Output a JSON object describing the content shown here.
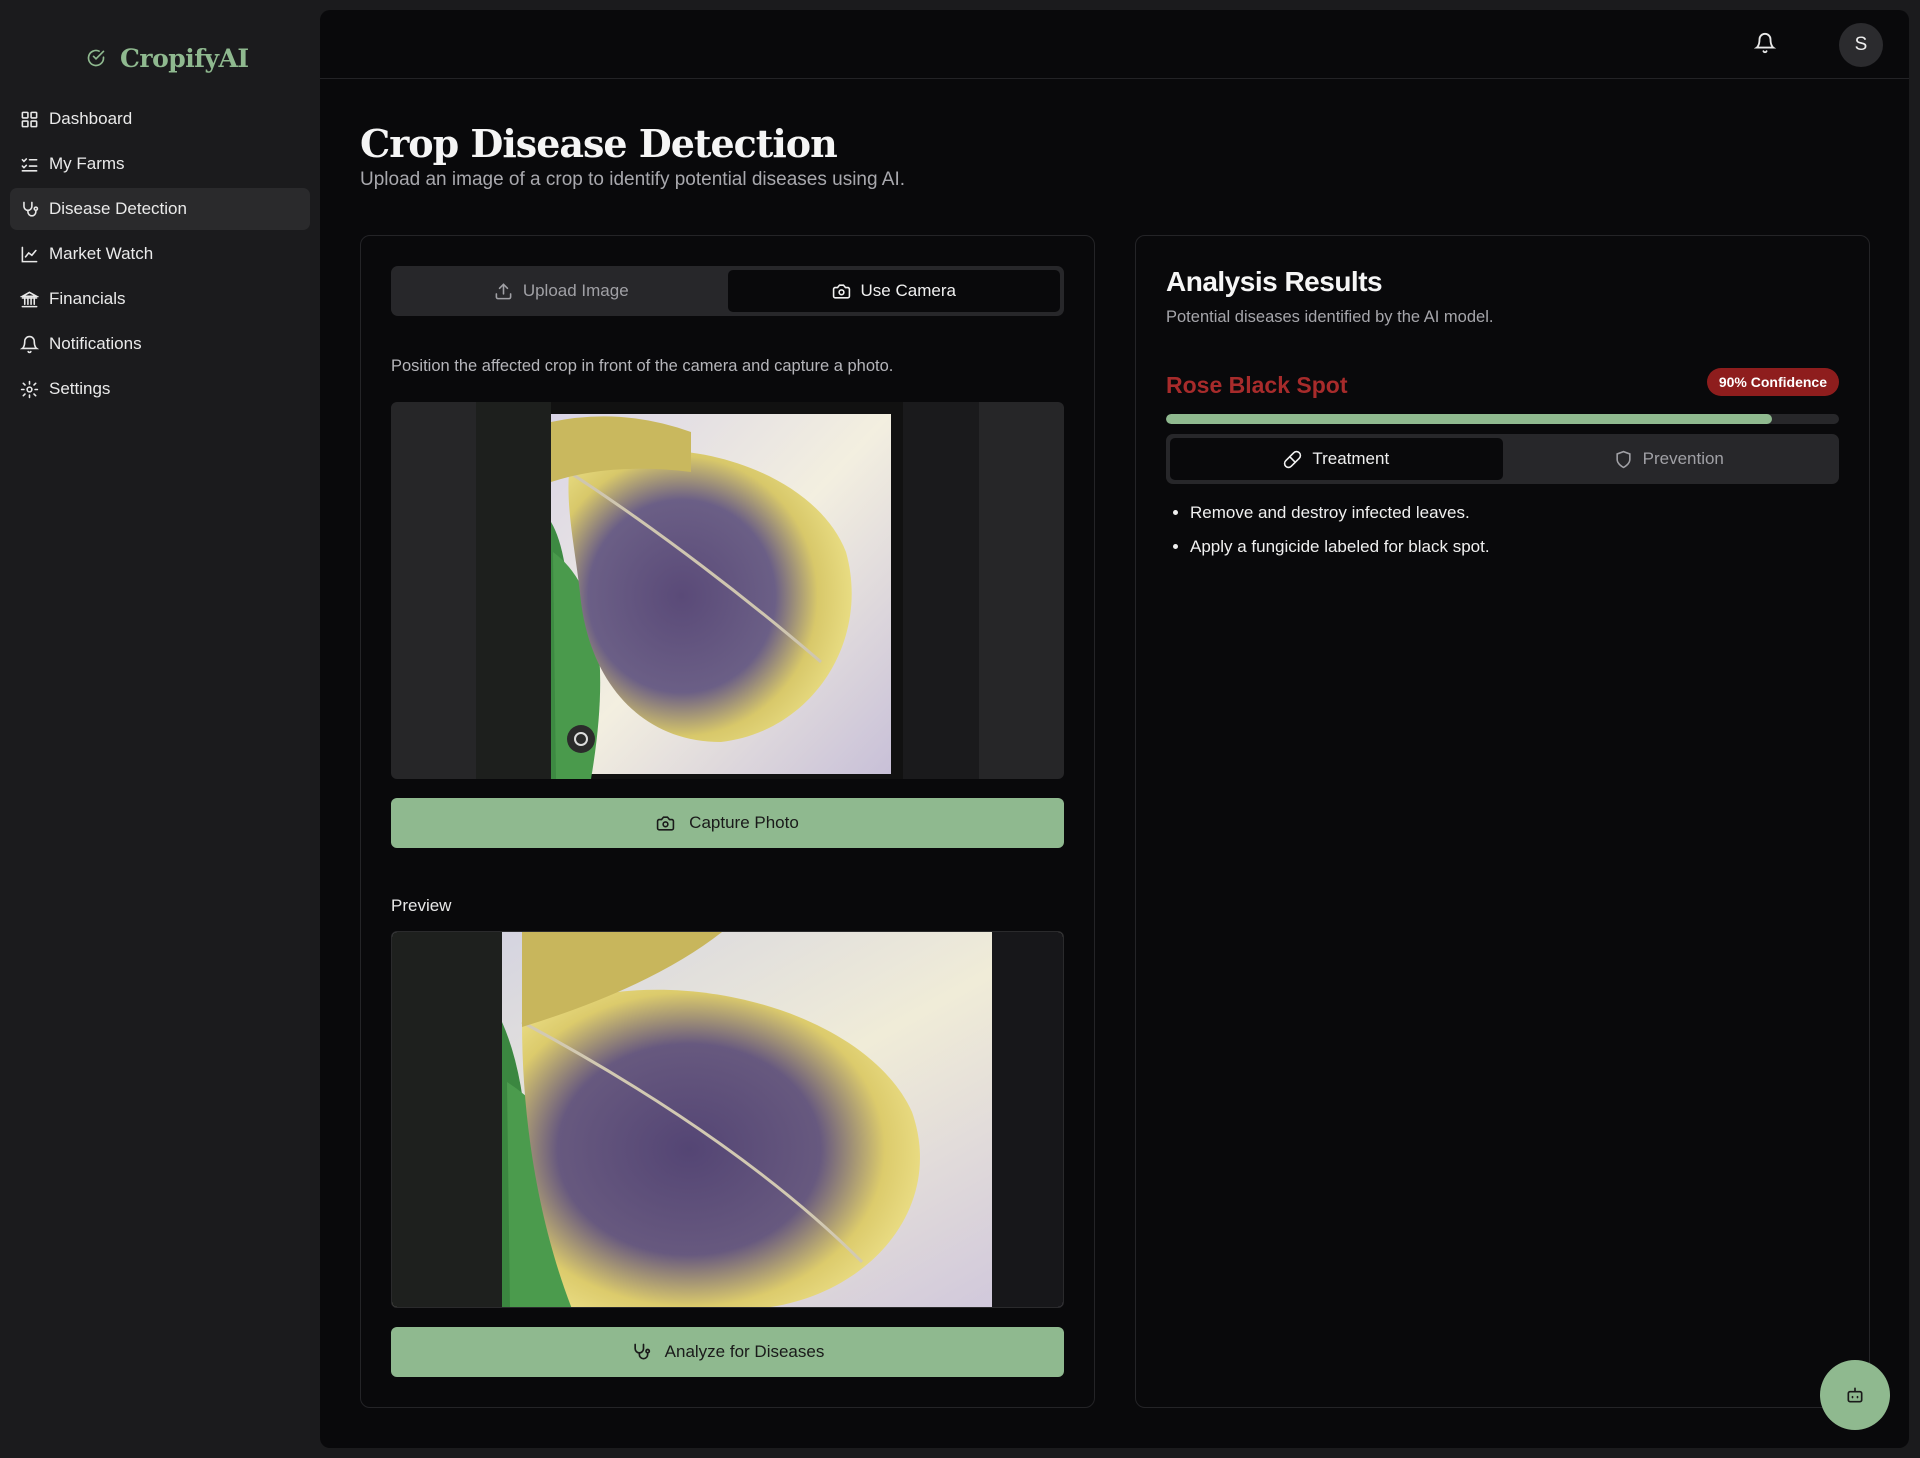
{
  "brand": {
    "name": "CropifyAI",
    "accent": "#8fb98f"
  },
  "nav": {
    "items": [
      {
        "label": "Dashboard",
        "icon": "dashboard-grid-icon"
      },
      {
        "label": "My Farms",
        "icon": "list-checks-icon"
      },
      {
        "label": "Disease Detection",
        "icon": "stethoscope-icon",
        "active": true
      },
      {
        "label": "Market Watch",
        "icon": "line-chart-icon"
      },
      {
        "label": "Financials",
        "icon": "bank-icon"
      },
      {
        "label": "Notifications",
        "icon": "bell-icon"
      },
      {
        "label": "Settings",
        "icon": "gear-icon"
      }
    ]
  },
  "header": {
    "avatar_initial": "S"
  },
  "page": {
    "title": "Crop Disease Detection",
    "subtitle": "Upload an image of a crop to identify potential diseases using AI."
  },
  "input": {
    "tabs": [
      {
        "label": "Upload Image",
        "icon": "upload-icon"
      },
      {
        "label": "Use Camera",
        "icon": "camera-icon",
        "active": true
      }
    ],
    "hint": "Position the affected crop in front of the camera and capture a photo.",
    "capture_label": "Capture Photo",
    "preview_label": "Preview",
    "analyze_label": "Analyze for Diseases"
  },
  "results": {
    "title": "Analysis Results",
    "subtitle": "Potential diseases identified by the AI model.",
    "disease": "Rose Black Spot",
    "confidence_label": "90% Confidence",
    "confidence": 0.9,
    "tabs": [
      {
        "label": "Treatment",
        "icon": "pill-icon",
        "active": true
      },
      {
        "label": "Prevention",
        "icon": "shield-icon"
      }
    ],
    "treatment": [
      "Remove and destroy infected leaves.",
      "Apply a fungicide labeled for black spot."
    ]
  },
  "colors": {
    "danger": "#a72b2b",
    "badge": "#8e1d1d",
    "accent": "#8fb98f"
  }
}
